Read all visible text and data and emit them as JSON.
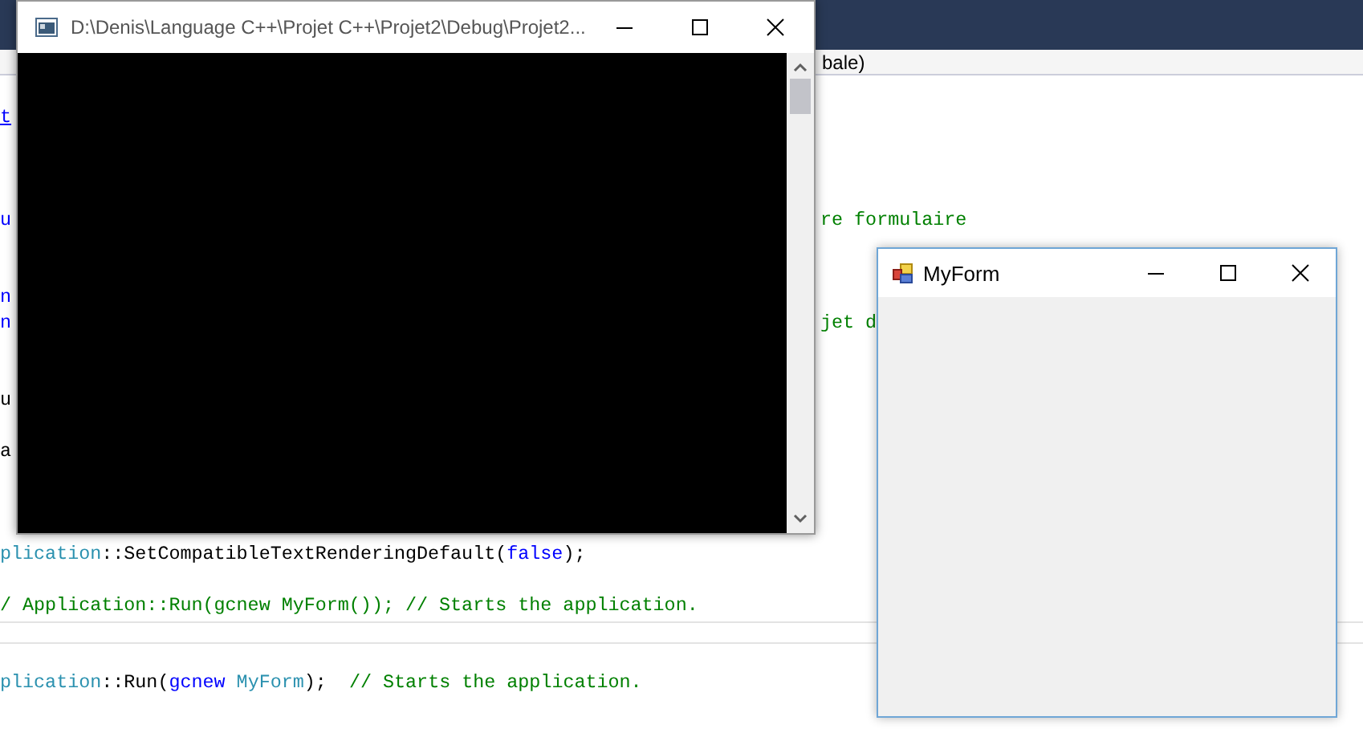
{
  "editor": {
    "navigation_bar": {
      "scope": "bale)"
    },
    "lines": [
      {
        "kind": "code",
        "left": [
          {
            "text": "t",
            "kind": "link"
          }
        ]
      },
      {
        "kind": "code"
      },
      {
        "kind": "code"
      },
      {
        "kind": "code"
      },
      {
        "kind": "code",
        "left": [
          {
            "text": "u",
            "kind": "keyword"
          }
        ],
        "right": [
          {
            "text": "re formulaire",
            "kind": "comment"
          }
        ]
      },
      {
        "kind": "code"
      },
      {
        "kind": "code"
      },
      {
        "kind": "code",
        "left": [
          {
            "text": "n",
            "kind": "keyword"
          }
        ]
      },
      {
        "kind": "code",
        "left": [
          {
            "text": "n",
            "kind": "keyword"
          }
        ],
        "right": [
          {
            "text": "jet d",
            "kind": "comment"
          }
        ]
      },
      {
        "kind": "code"
      },
      {
        "kind": "code"
      },
      {
        "kind": "code",
        "left": [
          {
            "text": "u",
            "kind": "plain"
          }
        ]
      },
      {
        "kind": "code"
      },
      {
        "kind": "code",
        "left": [
          {
            "text": "a",
            "kind": "plain"
          }
        ]
      },
      {
        "kind": "code"
      },
      {
        "kind": "code"
      },
      {
        "kind": "code"
      },
      {
        "kind": "code",
        "left": [
          {
            "text": "plication",
            "kind": "type"
          },
          {
            "text": "::SetCompatibleTextRenderingDefault(",
            "kind": "plain"
          },
          {
            "text": "false",
            "kind": "keyword"
          },
          {
            "text": ");",
            "kind": "plain"
          }
        ]
      },
      {
        "kind": "code"
      },
      {
        "kind": "code",
        "left": [
          {
            "text": "/ Application::Run(gcnew MyForm()); // Starts the application.",
            "kind": "comment"
          }
        ]
      },
      {
        "kind": "separator"
      },
      {
        "kind": "code"
      },
      {
        "kind": "code",
        "left": [
          {
            "text": "plication",
            "kind": "type"
          },
          {
            "text": "::Run(",
            "kind": "plain"
          },
          {
            "text": "gcnew",
            "kind": "keyword"
          },
          {
            "text": " MyForm",
            "kind": "type"
          },
          {
            "text": ");  ",
            "kind": "plain"
          },
          {
            "text": "// Starts the application.",
            "kind": "comment"
          }
        ]
      }
    ]
  },
  "console_window": {
    "title": "D:\\Denis\\Language C++\\Projet C++\\Projet2\\Debug\\Projet2..."
  },
  "form_window": {
    "title": "MyForm"
  }
}
